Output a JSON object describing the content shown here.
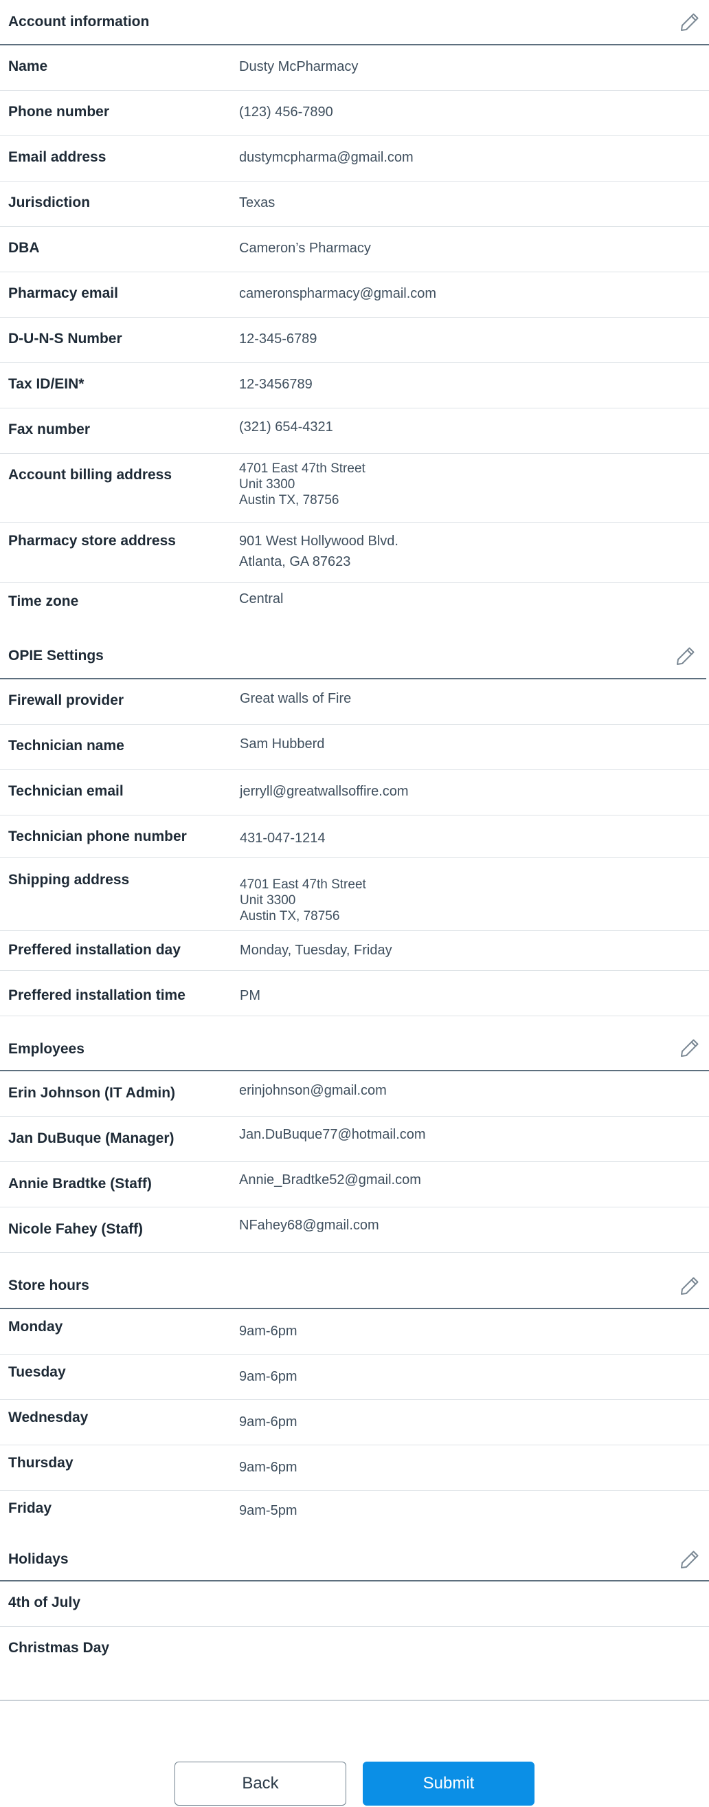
{
  "account": {
    "title": "Account information",
    "rows": [
      {
        "label": "Name",
        "value": "Dusty McPharmacy"
      },
      {
        "label": "Phone number",
        "value": "(123) 456-7890"
      },
      {
        "label": "Email address",
        "value": "dustymcpharma@gmail.com"
      },
      {
        "label": "Jurisdiction",
        "value": "Texas"
      },
      {
        "label": "DBA",
        "value": "Cameron’s Pharmacy"
      },
      {
        "label": "Pharmacy email",
        "value": "cameronspharmacy@gmail.com"
      },
      {
        "label": "D-U-N-S Number",
        "value": "12-345-6789"
      },
      {
        "label": "Tax ID/EIN*",
        "value": "12-3456789"
      },
      {
        "label": "Fax number",
        "value": "(321) 654-4321"
      }
    ],
    "billing": {
      "label": "Account billing address",
      "lines": [
        "4701 East 47th Street",
        "Unit 3300",
        "Austin TX, 78756"
      ]
    },
    "store_address": {
      "label": "Pharmacy store address",
      "lines": [
        "901 West Hollywood Blvd.",
        "Atlanta, GA 87623"
      ]
    },
    "timezone": {
      "label": "Time zone",
      "value": "Central"
    }
  },
  "opie": {
    "title": "OPIE Settings",
    "rows": [
      {
        "label": "Firewall provider",
        "value": "Great walls of Fire"
      },
      {
        "label": "Technician name",
        "value": "Sam Hubberd"
      },
      {
        "label": "Technician email",
        "value": "jerryll@greatwallsoffire.com"
      },
      {
        "label": "Technician phone number",
        "value": "431-047-1214"
      }
    ],
    "shipping": {
      "label": "Shipping address",
      "lines": [
        "4701 East 47th Street",
        "Unit 3300",
        "Austin TX, 78756"
      ]
    },
    "install_day": {
      "label": "Preffered installation day",
      "value": "Monday, Tuesday, Friday"
    },
    "install_time": {
      "label": "Preffered installation time",
      "value": "PM"
    }
  },
  "employees": {
    "title": "Employees",
    "rows": [
      {
        "label": "Erin Johnson (IT Admin)",
        "value": "erinjohnson@gmail.com"
      },
      {
        "label": "Jan DuBuque (Manager)",
        "value": "Jan.DuBuque77@hotmail.com"
      },
      {
        "label": "Annie Bradtke (Staff)",
        "value": "Annie_Bradtke52@gmail.com"
      },
      {
        "label": "Nicole Fahey (Staff)",
        "value": "NFahey68@gmail.com"
      }
    ]
  },
  "store_hours": {
    "title": "Store hours",
    "rows": [
      {
        "label": "Monday",
        "value": "9am-6pm"
      },
      {
        "label": "Tuesday",
        "value": "9am-6pm"
      },
      {
        "label": "Wednesday",
        "value": "9am-6pm"
      },
      {
        "label": "Thursday",
        "value": "9am-6pm"
      },
      {
        "label": "Friday",
        "value": "9am-5pm"
      }
    ]
  },
  "holidays": {
    "title": "Holidays",
    "rows": [
      {
        "label": "4th of July"
      },
      {
        "label": "Christmas Day"
      }
    ]
  },
  "buttons": {
    "back": "Back",
    "submit": "Submit"
  },
  "colors": {
    "accent": "#0b8fe6",
    "label_text": "#1e2a36",
    "value_text": "#3f4f5e",
    "divider": "#dde2e6",
    "section_rule": "#5d6f7e"
  },
  "icons": {
    "edit": "pencil-icon"
  }
}
